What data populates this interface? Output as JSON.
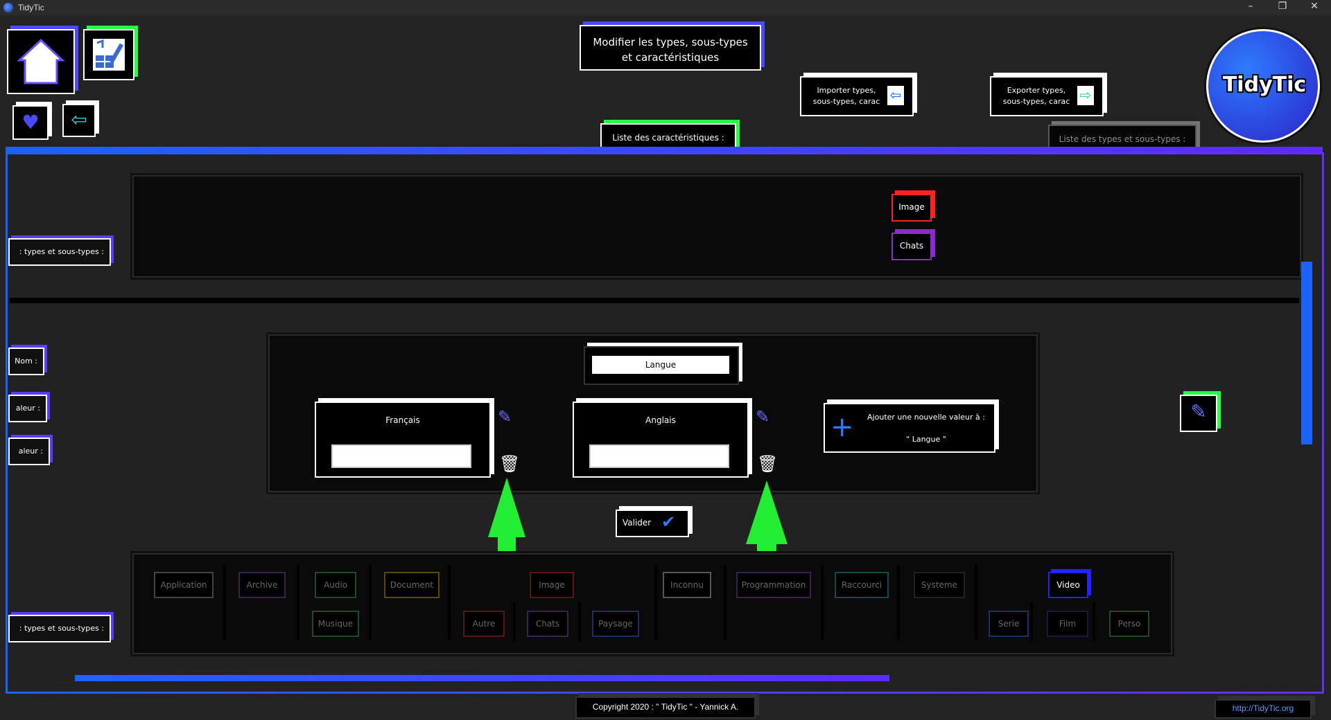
{
  "window": {
    "title": "TidyTic",
    "minimize": "–",
    "restore": "❐",
    "close": "✕"
  },
  "header": {
    "title_line1": "Modifier les types, sous-types",
    "title_line2": "et caractéristiques",
    "import_line1": "Importer types,",
    "import_line2": "sous-types, carac",
    "export_line1": "Exporter types,",
    "export_line2": "sous-types, carac",
    "logo_text": "TidyTic",
    "tab_characteristics": "Liste des caractéristiques :",
    "tab_types": "Liste des types et sous-types :"
  },
  "sidebar": {
    "types_label_top": ": types et sous-types :",
    "nom_label": "Nom :",
    "valeur_label_1": "aleur :",
    "valeur_label_2": "aleur :",
    "types_label_bottom": ": types et sous-types :"
  },
  "characteristics": [
    "Image",
    "Chats"
  ],
  "editor": {
    "name_value": "Langue",
    "values": [
      {
        "label": "Français",
        "input": ""
      },
      {
        "label": "Anglais",
        "input": ""
      }
    ],
    "add_line1": "Ajouter une nouvelle valeur à :",
    "add_line2": "\" Langue \"",
    "validate": "Valider"
  },
  "types_grid": {
    "application": "Application",
    "archive": "Archive",
    "audio": "Audio",
    "musique": "Musique",
    "document": "Document",
    "image": "Image",
    "autre": "Autre",
    "chats": "Chats",
    "paysage": "Paysage",
    "inconnu": "Inconnu",
    "programmation": "Programmation",
    "raccourci": "Raccourci",
    "systeme": "Systeme",
    "video": "Video",
    "serie": "Serie",
    "film": "Film",
    "perso": "Perso"
  },
  "footer": {
    "copyright": "Copyright 2020 : \" TidyTic \" - Yannick A.",
    "url": "http://TidyTic.org"
  },
  "colors": {
    "accent_blue": "#1b63ff",
    "accent_purple": "#5b2bff",
    "green": "#22ff44",
    "red": "#ff2222"
  }
}
